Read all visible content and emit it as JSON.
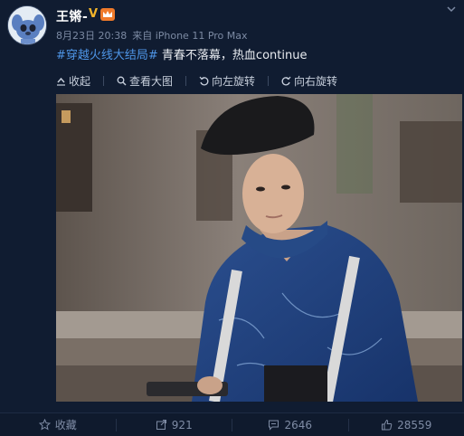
{
  "post": {
    "username": "王锵-",
    "badge_v": "V",
    "date": "8月23日 20:38",
    "source": "来自 iPhone 11 Pro Max",
    "hashtag": "#穿越火线大结局#",
    "text": " 青春不落幕，热血continue"
  },
  "toolbar": {
    "collapse": "收起",
    "view_large": "查看大图",
    "rotate_left": "向左旋转",
    "rotate_right": "向右旋转"
  },
  "actions": {
    "favorite": "收藏",
    "repost_count": "921",
    "comment_count": "2646",
    "like_count": "28559"
  },
  "colors": {
    "background": "#101c31",
    "link": "#4e95e6",
    "badge": "#f2b42a"
  }
}
